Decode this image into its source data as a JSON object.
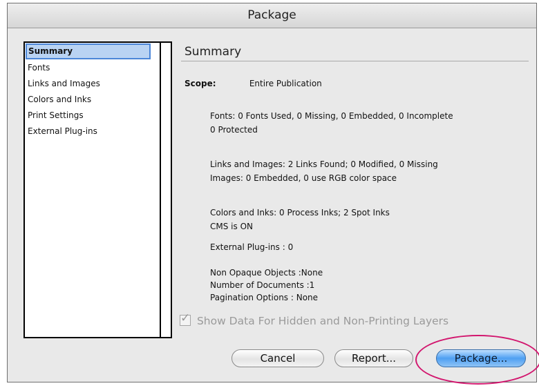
{
  "window": {
    "title": "Package"
  },
  "sidebar": {
    "items": [
      {
        "label": "Summary",
        "selected": true
      },
      {
        "label": "Fonts",
        "selected": false
      },
      {
        "label": "Links and Images",
        "selected": false
      },
      {
        "label": "Colors and Inks",
        "selected": false
      },
      {
        "label": "Print Settings",
        "selected": false
      },
      {
        "label": "External Plug-ins",
        "selected": false
      }
    ]
  },
  "summary": {
    "title": "Summary",
    "scope_label": "Scope:",
    "scope_value": "Entire Publication",
    "fonts": [
      "Fonts: 0 Fonts Used, 0 Missing, 0 Embedded, 0 Incomplete",
      "0 Protected"
    ],
    "links": [
      "Links and Images: 2 Links Found; 0 Modified, 0 Missing",
      "Images: 0 Embedded, 0 use RGB color space"
    ],
    "colors": [
      "Colors and Inks: 0 Process Inks; 2 Spot Inks",
      "CMS is ON"
    ],
    "plugins": "External Plug-ins : 0",
    "misc": [
      "Non Opaque Objects :None",
      "Number of Documents :1",
      "Pagination Options : None"
    ]
  },
  "options": {
    "show_hidden_label": "Show Data For Hidden and Non-Printing Layers",
    "show_hidden_checked": true
  },
  "buttons": {
    "cancel": "Cancel",
    "report": "Report...",
    "package": "Package..."
  },
  "colors": {
    "highlight": "#d2166e",
    "default_button": "#4fa0f2",
    "selection": "#b9d3f3"
  }
}
